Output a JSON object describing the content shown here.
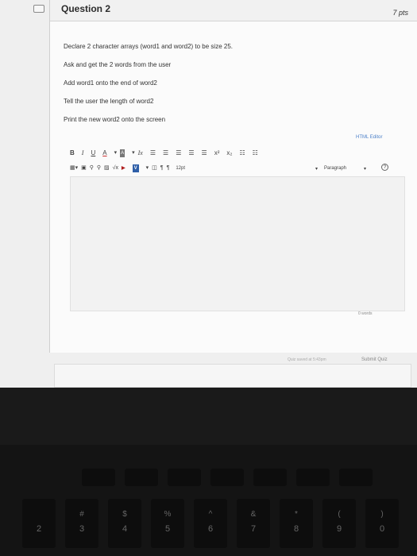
{
  "question": {
    "title": "Question 2",
    "points": "7 pts",
    "lines": [
      "Declare 2 character arrays (word1 and word2) to be size 25.",
      "Ask and get the 2 words from the user",
      "Add word1 onto the end of word2",
      "Tell the user the length of word2",
      "Print the new word2  onto the screen"
    ]
  },
  "editor": {
    "html_editor_link": "HTML Editor",
    "toolbar_row1": [
      "B",
      "I",
      "U",
      "A",
      "A",
      "Ix",
      "x²",
      "x₂"
    ],
    "font_size": "12pt",
    "paragraph": "Paragraph",
    "word_count": "0 words",
    "help_icon": "help-icon"
  },
  "footer": {
    "saved_status": "Quiz saved at 5:43pm",
    "submit_label": "Submit Quiz"
  },
  "keyboard": {
    "number_keys": [
      {
        "top": "",
        "bottom": "2"
      },
      {
        "top": "#",
        "bottom": "3"
      },
      {
        "top": "$",
        "bottom": "4"
      },
      {
        "top": "%",
        "bottom": "5"
      },
      {
        "top": "^",
        "bottom": "6"
      },
      {
        "top": "&",
        "bottom": "7"
      },
      {
        "top": "*",
        "bottom": "8"
      },
      {
        "top": "(",
        "bottom": "9"
      },
      {
        "top": ")",
        "bottom": "0"
      }
    ]
  }
}
